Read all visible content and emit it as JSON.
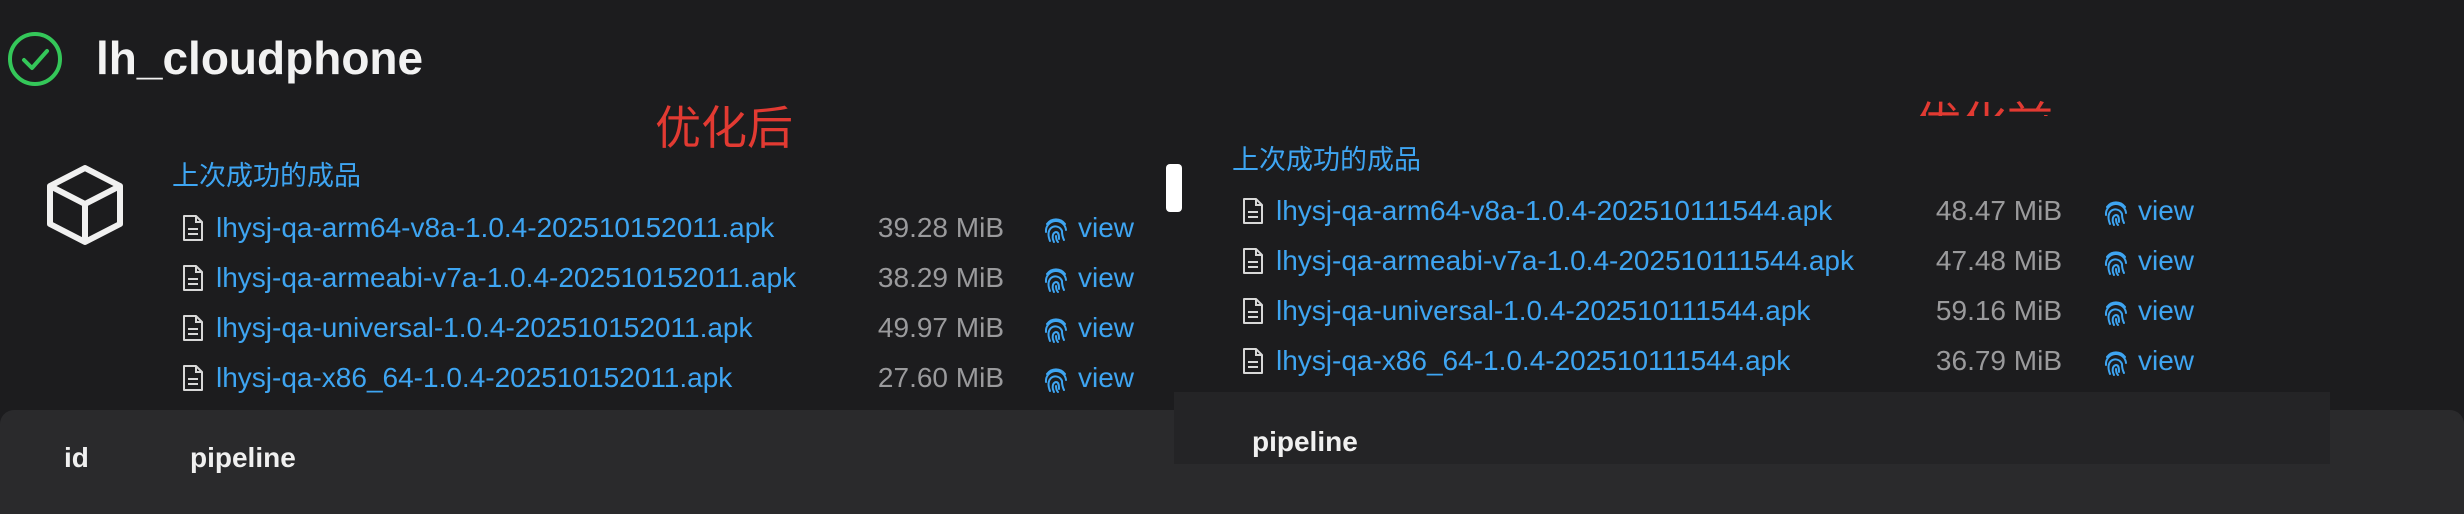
{
  "header": {
    "title": "lh_cloudphone",
    "status_icon": "check-circle-icon",
    "status_color": "#34c759"
  },
  "annotations": {
    "after": "优化后",
    "before": "优化前",
    "color": "#e23a32"
  },
  "after_panel": {
    "section_label": "上次成功的成品",
    "artifacts": [
      {
        "name": "lhysj-qa-arm64-v8a-1.0.4-202510152011.apk",
        "size": "39.28 MiB",
        "action": "view"
      },
      {
        "name": "lhysj-qa-armeabi-v7a-1.0.4-202510152011.apk",
        "size": "38.29 MiB",
        "action": "view"
      },
      {
        "name": "lhysj-qa-universal-1.0.4-202510152011.apk",
        "size": "49.97 MiB",
        "action": "view"
      },
      {
        "name": "lhysj-qa-x86_64-1.0.4-202510152011.apk",
        "size": "27.60 MiB",
        "action": "view"
      }
    ]
  },
  "before_panel": {
    "section_label": "上次成功的成品",
    "artifacts": [
      {
        "name": "lhysj-qa-arm64-v8a-1.0.4-202510111544.apk",
        "size": "48.47 MiB",
        "action": "view"
      },
      {
        "name": "lhysj-qa-armeabi-v7a-1.0.4-202510111544.apk",
        "size": "47.48 MiB",
        "action": "view"
      },
      {
        "name": "lhysj-qa-universal-1.0.4-202510111544.apk",
        "size": "59.16 MiB",
        "action": "view"
      },
      {
        "name": "lhysj-qa-x86_64-1.0.4-202510111544.apk",
        "size": "36.79 MiB",
        "action": "view"
      }
    ],
    "table_header": "pipeline"
  },
  "table": {
    "columns": [
      "id",
      "pipeline"
    ]
  },
  "colors": {
    "background": "#1c1c1e",
    "link": "#3ea5f2",
    "muted": "#9a9a9c"
  }
}
